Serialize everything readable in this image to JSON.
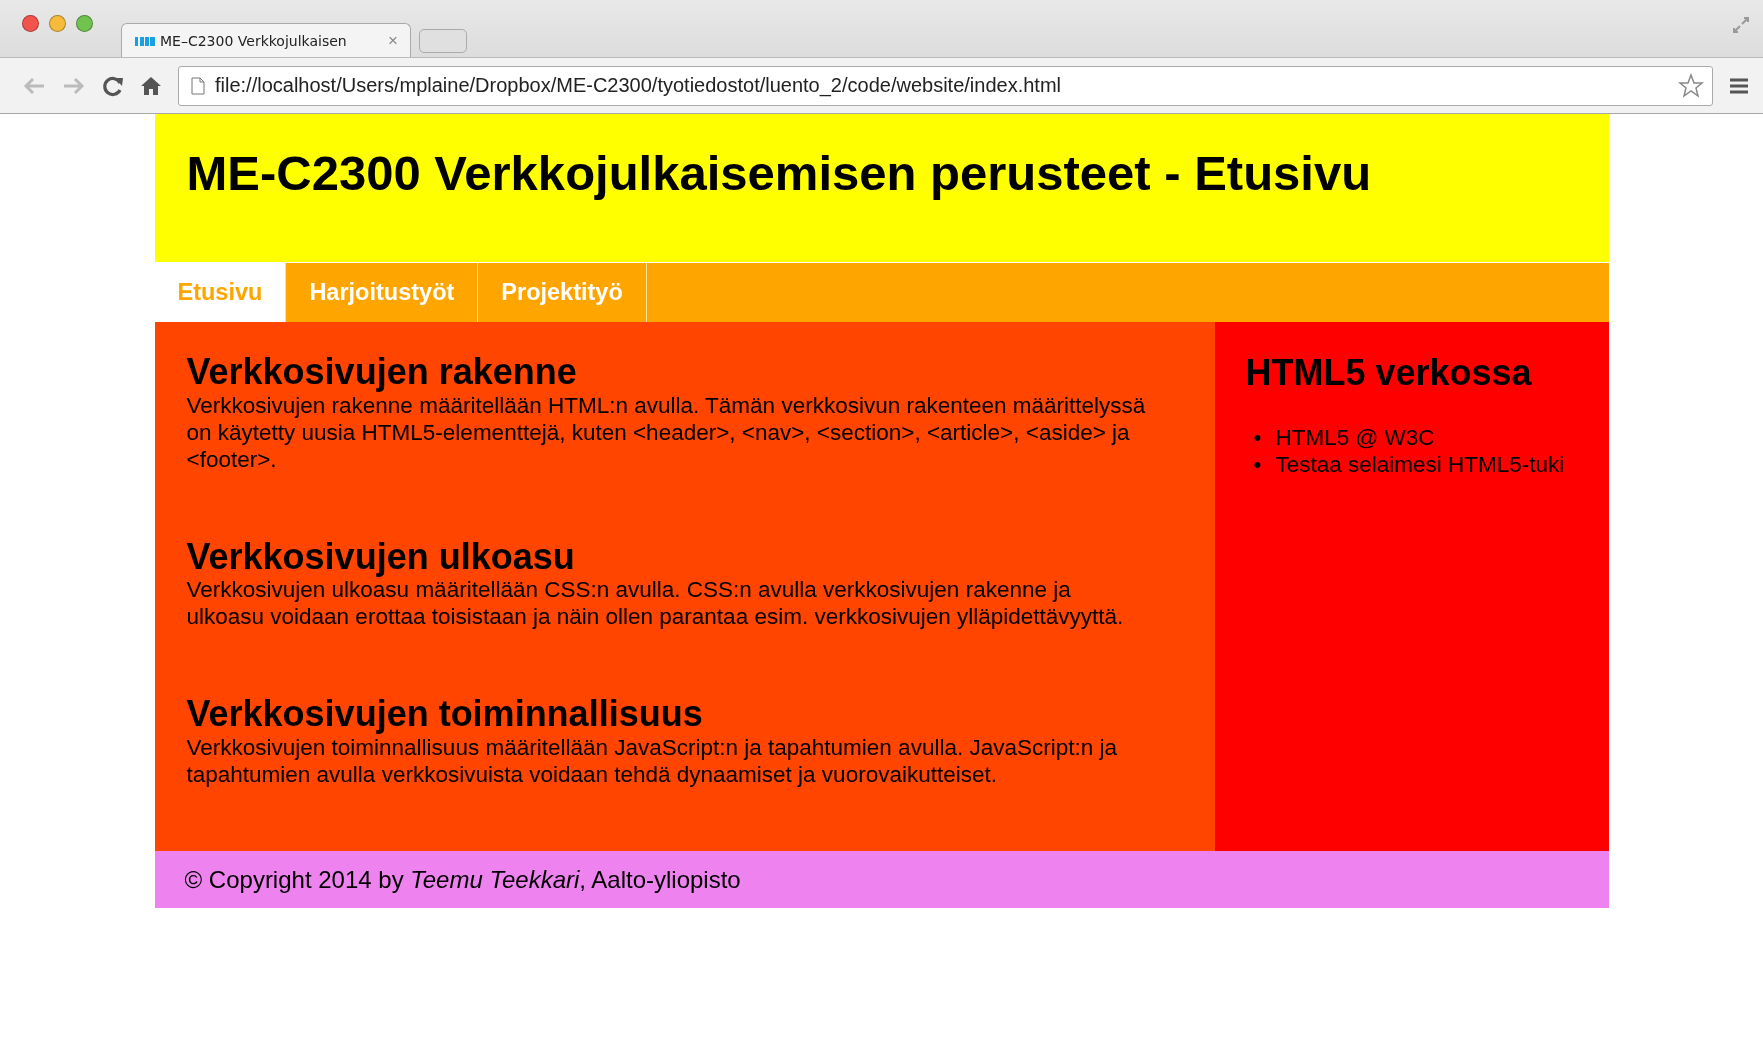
{
  "browser": {
    "tab": {
      "title": "ME–C2300 Verkkojulkaisen",
      "close": "×"
    },
    "address": "file://localhost/Users/mplaine/Dropbox/ME-C2300/tyotiedostot/luento_2/code/website/index.html"
  },
  "header": {
    "title": "ME-C2300 Verkkojulkaisemisen perusteet - Etusivu"
  },
  "nav": [
    {
      "label": "Etusivu",
      "selected": true
    },
    {
      "label": "Harjoitustyöt",
      "selected": false
    },
    {
      "label": "Projektityö",
      "selected": false
    }
  ],
  "sections": [
    {
      "heading": "Verkkosivujen rakenne",
      "text": "Verkkosivujen rakenne määritellään HTML:n avulla. Tämän verkkosivun rakenteen määrittelyssä on käytetty uusia HTML5-elementtejä, kuten <header>, <nav>, <section>, <article>, <aside> ja <footer>."
    },
    {
      "heading": "Verkkosivujen ulkoasu",
      "text": "Verkkosivujen ulkoasu määritellään CSS:n avulla. CSS:n avulla verkkosivujen rakenne ja ulkoasu voidaan erottaa toisistaan ja näin ollen parantaa esim. verkkosivujen ylläpidettävyyttä."
    },
    {
      "heading": "Verkkosivujen toiminnallisuus",
      "text": "Verkkosivujen toiminnallisuus määritellään JavaScript:n ja tapahtumien avulla. JavaScript:n ja tapahtumien avulla verkkosivuista voidaan tehdä dynaamiset ja vuorovaikutteiset."
    }
  ],
  "aside": {
    "heading": "HTML5 verkossa",
    "links": [
      {
        "marker": "•",
        "label": "HTML5 @ W3C"
      },
      {
        "marker": "•",
        "label": "Testaa selaimesi HTML5-tuki"
      }
    ]
  },
  "footer": {
    "text": "© Copyright 2014 by *Teemu Teekkari*, Aalto-yliopisto"
  }
}
